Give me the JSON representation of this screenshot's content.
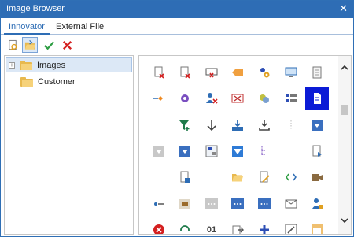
{
  "window": {
    "title": "Image Browser",
    "close_glyph": "✕"
  },
  "tabs": [
    {
      "label": "Innovator"
    },
    {
      "label": "External File"
    }
  ],
  "toolbar": {
    "buttons": [
      {
        "name": "new-image-icon"
      },
      {
        "name": "open-folder-icon"
      },
      {
        "name": "check-icon"
      },
      {
        "name": "delete-x-icon"
      }
    ]
  },
  "tree": {
    "items": [
      {
        "label": "Images",
        "selected": true,
        "expander": "+"
      },
      {
        "label": "Customer",
        "selected": false
      }
    ]
  },
  "icon_grid": {
    "rows": [
      [
        "doc-x-icon",
        "doc-x-icon",
        "card-x-icon",
        "tag-icon",
        "users-gear-icon",
        "monitor-icon",
        "document-lines-icon"
      ],
      [
        "diamond-arrow-icon",
        "gear-purple-icon",
        "user-x-icon",
        "mail-x-icon",
        "coins-icon",
        "list-icon",
        "page-selected-icon"
      ],
      [
        "",
        "filter-add-icon",
        "arrow-down-icon",
        "inbox-download-icon",
        "download-icon",
        "dotted-line-icon",
        "dropdown-blue-icon"
      ],
      [
        "dropdown-gray-icon",
        "dropdown-blue-icon",
        "grid-form-icon",
        "dropdown-white-icon",
        "tree-small-icon",
        "",
        "doc-play-icon"
      ],
      [
        "",
        "doc-question-icon",
        "",
        "folder-open-icon",
        "doc-pencil-icon",
        "arrows-diamond-icon",
        "camera-icon"
      ],
      [
        "line-dot-icon",
        "box-brown-icon",
        "ellipsis-gray-icon",
        "ellipsis-blue-icon",
        "ellipsis-blue-icon",
        "envelope-icon",
        "user-doc-icon"
      ],
      [
        "stop-red-icon",
        "headset-icon",
        "binary-icon",
        "export-icon",
        "plus-blue-icon",
        "frame-arrow-icon",
        "window-orange-icon"
      ]
    ],
    "selected_icon": "page-selected-icon",
    "partial_row_label": "01"
  },
  "colors": {
    "titlebar": "#2e6db5",
    "selection": "#0b1bd6",
    "tab_active": "#2e6db5"
  }
}
